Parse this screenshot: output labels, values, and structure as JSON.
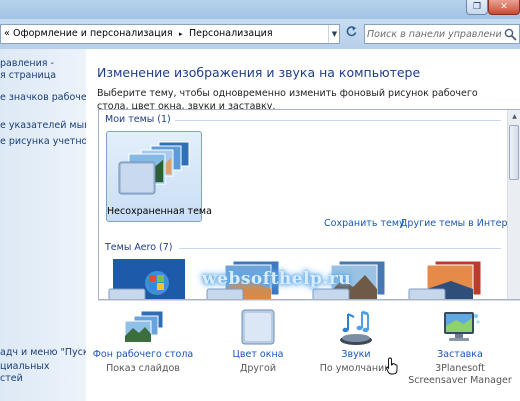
{
  "window": {
    "max_icon": "restore-icon",
    "close_icon": "close-x-icon"
  },
  "address": {
    "chevrons": "«",
    "crumbs": [
      "Оформление и персонализация",
      "Персонализация"
    ],
    "separator": "▸"
  },
  "search": {
    "placeholder": "Поиск в панели управления"
  },
  "left_nav": {
    "items": [
      "равления -",
      "я страница",
      "е значков рабочего",
      "е указателей мыши",
      "е рисунка учетной"
    ],
    "see_also": [
      "адч и меню \"Пуск\"",
      "циальных",
      "стей"
    ]
  },
  "main": {
    "title": "Изменение изображения и звука на компьютере",
    "description": "Выберите тему, чтобы одновременно изменить фоновый рисунок рабочего стола, цвет окна, звуки и заставку."
  },
  "themes": {
    "my_themes_label": "Мои темы (1)",
    "unsaved_theme": "Несохраненная тема",
    "save_link": "Сохранить тему",
    "online_link": "Другие темы в Интернете",
    "aero_label": "Темы Aero (7)"
  },
  "bottom": [
    {
      "label": "Фон рабочего стола",
      "value": "Показ слайдов",
      "icon": "desktop-background-icon"
    },
    {
      "label": "Цвет окна",
      "value": "Другой",
      "icon": "window-color-icon"
    },
    {
      "label": "Звуки",
      "value": "По умолчанию",
      "icon": "sounds-icon"
    },
    {
      "label": "Заставка",
      "value": "3Planesoft Screensaver Manager",
      "icon": "screensaver-icon"
    }
  ],
  "watermark": "websofthelp.ru",
  "colors": {
    "link": "#1a56b8",
    "title": "#1e3d87",
    "nav_bg": "#dde9f5",
    "addr_bg": "#c9ddf2"
  }
}
